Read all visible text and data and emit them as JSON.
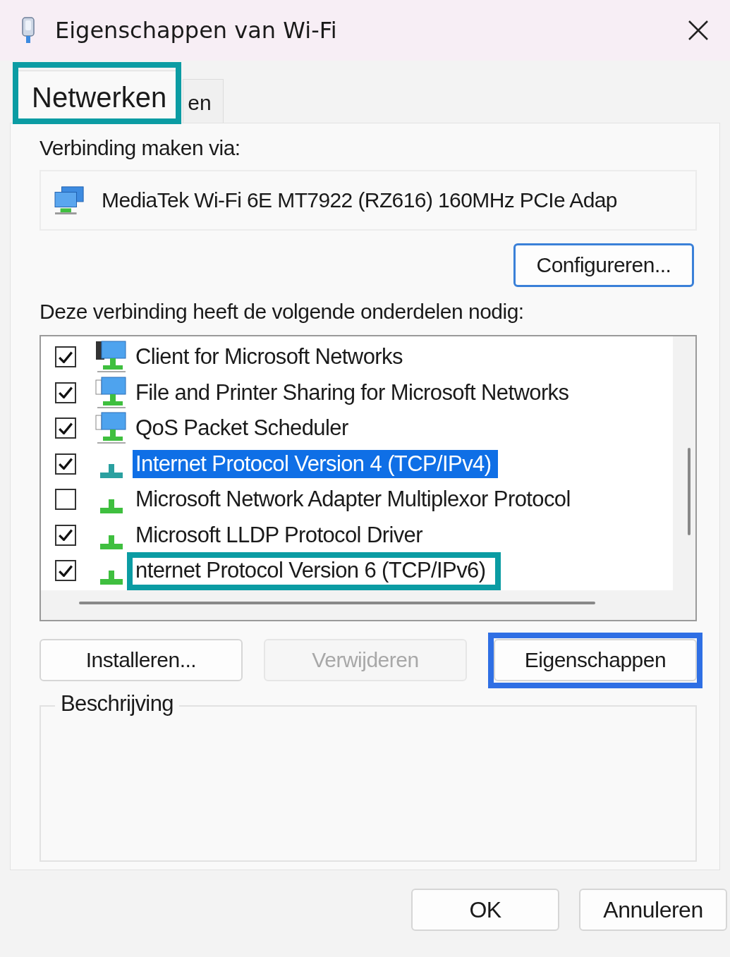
{
  "window": {
    "title": "Eigenschappen van Wi-Fi"
  },
  "tabs": [
    {
      "label": "Netwerken",
      "selected": true,
      "highlighted": true
    },
    {
      "label": "en",
      "selected": false
    }
  ],
  "connect_label": "Verbinding maken via:",
  "adapter": {
    "name": "MediaTek Wi-Fi 6E MT7922 (RZ616) 160MHz PCIe Adap"
  },
  "configure_button": {
    "label": "Configureren..."
  },
  "components_label": "Deze verbinding heeft de volgende onderdelen nodig:",
  "components": [
    {
      "label": "Client for Microsoft Networks",
      "kind": "client",
      "checked": true,
      "selected": false
    },
    {
      "label": "File and Printer Sharing for Microsoft Networks",
      "kind": "service",
      "checked": true,
      "selected": false
    },
    {
      "label": "QoS Packet Scheduler",
      "kind": "service",
      "checked": true,
      "selected": false
    },
    {
      "label": "Internet Protocol Version 4 (TCP/IPv4)",
      "kind": "protocol",
      "checked": true,
      "selected": true
    },
    {
      "label": "Microsoft Network Adapter Multiplexor Protocol",
      "kind": "protocol",
      "checked": false,
      "selected": false
    },
    {
      "label": "Microsoft LLDP Protocol Driver",
      "kind": "protocol",
      "checked": true,
      "selected": false
    },
    {
      "label": "nternet Protocol Version 6 (TCP/IPv6)",
      "kind": "protocol",
      "checked": true,
      "selected": false,
      "highlighted": true
    }
  ],
  "actions": [
    {
      "label": "Installeren...",
      "disabled": false
    },
    {
      "label": "Verwijderen",
      "disabled": true
    },
    {
      "label": "Eigenschappen",
      "disabled": false,
      "highlighted": true
    }
  ],
  "description": {
    "legend": "Beschrijving"
  },
  "footer_buttons": [
    {
      "label": "OK"
    },
    {
      "label": "Annuleren"
    }
  ]
}
